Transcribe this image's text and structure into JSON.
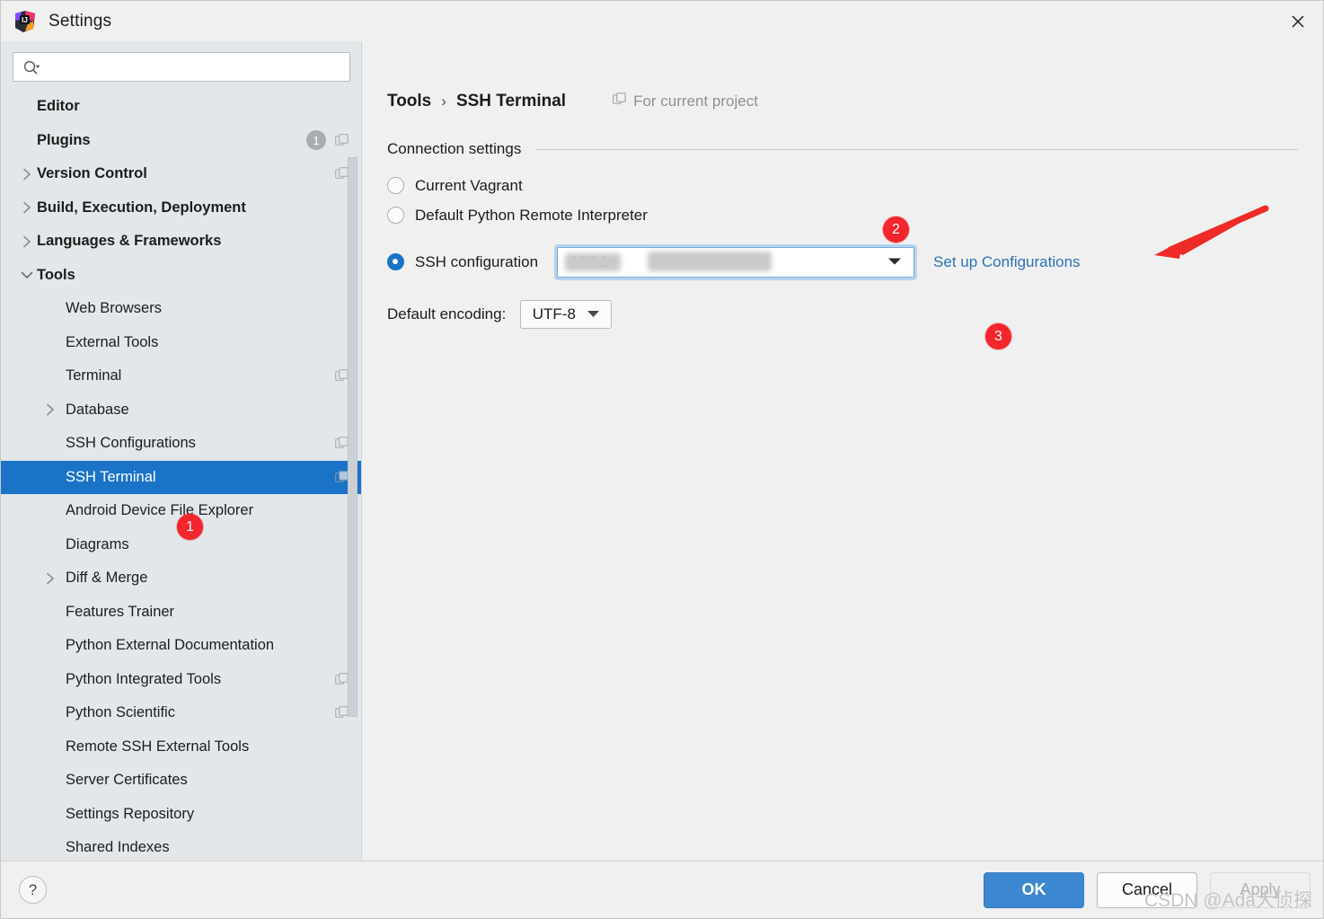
{
  "window": {
    "title": "Settings",
    "app_icon": "intellij-idea-logo",
    "close_icon": "close-icon"
  },
  "search": {
    "value": "",
    "placeholder": "",
    "icon": "search-icon"
  },
  "sidebar": {
    "items": [
      {
        "label": "Editor",
        "level": 0,
        "bold": true,
        "arrow": "",
        "badge": "",
        "copy": false,
        "selected": false
      },
      {
        "label": "Plugins",
        "level": 0,
        "bold": true,
        "arrow": "",
        "badge": "1",
        "copy": true,
        "selected": false
      },
      {
        "label": "Version Control",
        "level": 0,
        "bold": true,
        "arrow": "right",
        "badge": "",
        "copy": true,
        "selected": false
      },
      {
        "label": "Build, Execution, Deployment",
        "level": 0,
        "bold": true,
        "arrow": "right",
        "badge": "",
        "copy": false,
        "selected": false
      },
      {
        "label": "Languages & Frameworks",
        "level": 0,
        "bold": true,
        "arrow": "right",
        "badge": "",
        "copy": false,
        "selected": false
      },
      {
        "label": "Tools",
        "level": 0,
        "bold": true,
        "arrow": "down",
        "badge": "",
        "copy": false,
        "selected": false
      },
      {
        "label": "Web Browsers",
        "level": 1,
        "bold": false,
        "arrow": "",
        "badge": "",
        "copy": false,
        "selected": false
      },
      {
        "label": "External Tools",
        "level": 1,
        "bold": false,
        "arrow": "",
        "badge": "",
        "copy": false,
        "selected": false
      },
      {
        "label": "Terminal",
        "level": 1,
        "bold": false,
        "arrow": "",
        "badge": "",
        "copy": true,
        "selected": false
      },
      {
        "label": "Database",
        "level": 1,
        "bold": false,
        "arrow": "right",
        "badge": "",
        "copy": false,
        "selected": false
      },
      {
        "label": "SSH Configurations",
        "level": 1,
        "bold": false,
        "arrow": "",
        "badge": "",
        "copy": true,
        "selected": false
      },
      {
        "label": "SSH Terminal",
        "level": 1,
        "bold": false,
        "arrow": "",
        "badge": "",
        "copy": true,
        "selected": true
      },
      {
        "label": "Android Device File Explorer",
        "level": 1,
        "bold": false,
        "arrow": "",
        "badge": "",
        "copy": false,
        "selected": false
      },
      {
        "label": "Diagrams",
        "level": 1,
        "bold": false,
        "arrow": "",
        "badge": "",
        "copy": false,
        "selected": false
      },
      {
        "label": "Diff & Merge",
        "level": 1,
        "bold": false,
        "arrow": "right",
        "badge": "",
        "copy": false,
        "selected": false
      },
      {
        "label": "Features Trainer",
        "level": 1,
        "bold": false,
        "arrow": "",
        "badge": "",
        "copy": false,
        "selected": false
      },
      {
        "label": "Python External Documentation",
        "level": 1,
        "bold": false,
        "arrow": "",
        "badge": "",
        "copy": false,
        "selected": false
      },
      {
        "label": "Python Integrated Tools",
        "level": 1,
        "bold": false,
        "arrow": "",
        "badge": "",
        "copy": true,
        "selected": false
      },
      {
        "label": "Python Scientific",
        "level": 1,
        "bold": false,
        "arrow": "",
        "badge": "",
        "copy": true,
        "selected": false
      },
      {
        "label": "Remote SSH External Tools",
        "level": 1,
        "bold": false,
        "arrow": "",
        "badge": "",
        "copy": false,
        "selected": false
      },
      {
        "label": "Server Certificates",
        "level": 1,
        "bold": false,
        "arrow": "",
        "badge": "",
        "copy": false,
        "selected": false
      },
      {
        "label": "Settings Repository",
        "level": 1,
        "bold": false,
        "arrow": "",
        "badge": "",
        "copy": false,
        "selected": false
      },
      {
        "label": "Shared Indexes",
        "level": 1,
        "bold": false,
        "arrow": "",
        "badge": "",
        "copy": false,
        "selected": false
      }
    ],
    "scrollbar": "vertical-scrollbar"
  },
  "main": {
    "breadcrumb": {
      "parent": "Tools",
      "separator": "›",
      "current": "SSH Terminal"
    },
    "for_current_project": {
      "label": "For current project",
      "icon": "copy-icon"
    },
    "section": {
      "label": "Connection settings"
    },
    "options": [
      {
        "label": "Current Vagrant",
        "selected": false
      },
      {
        "label": "Default Python Remote Interpreter",
        "selected": false
      },
      {
        "label": "SSH configuration",
        "selected": true
      }
    ],
    "ssh_combo": {
      "value": "192.1",
      "redacted": true,
      "caret_icon": "chevron-down-icon",
      "focused": true
    },
    "setup_link": "Set up Configurations",
    "encoding": {
      "label": "Default encoding:",
      "value": "UTF-8",
      "caret_icon": "chevron-down-icon"
    }
  },
  "annotations": {
    "accent_color": "#f5252d",
    "badges": [
      {
        "number": "1",
        "target": "sidebar-item-ssh-terminal"
      },
      {
        "number": "2",
        "target": "ssh-configuration-combo"
      },
      {
        "number": "3",
        "target": "default-encoding-combo"
      }
    ],
    "arrow": {
      "color": "#ee2b28",
      "points_to": "ssh-configuration-combo"
    }
  },
  "footer": {
    "help_label": "?",
    "ok_label": "OK",
    "cancel_label": "Cancel",
    "apply_label": "Apply",
    "apply_disabled": true,
    "ok_color": "#3d87d0"
  },
  "watermark": "CSDN @Ada大侦探"
}
